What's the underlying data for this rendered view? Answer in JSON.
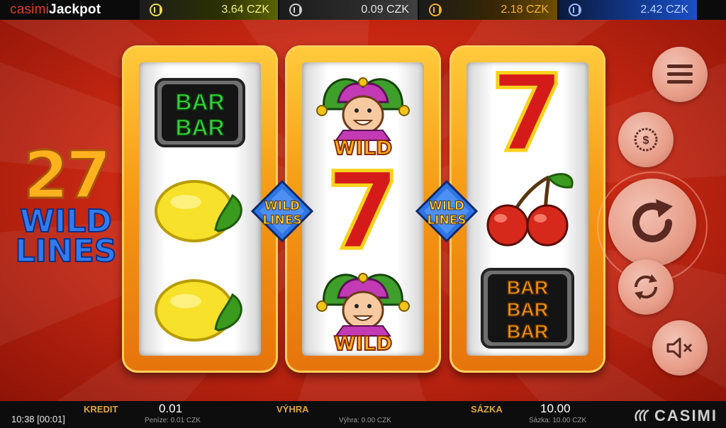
{
  "brand": {
    "part1": "casimi",
    "part2": "Jackpot"
  },
  "jackpots": [
    {
      "value": "3.64 CZK",
      "icon": "coin-icon",
      "color": "#f4ef86"
    },
    {
      "value": "0.09 CZK",
      "icon": "coin-icon",
      "color": "#e2e2e2"
    },
    {
      "value": "2.18 CZK",
      "icon": "coin-icon",
      "color": "#f2b12e"
    },
    {
      "value": "2.42 CZK",
      "icon": "coin-icon",
      "color": "#b9d2ff"
    }
  ],
  "game": {
    "title_number": "27",
    "title_line1": "WILD",
    "title_line2": "LINES",
    "badge_line1": "WILD",
    "badge_line2": "LINES",
    "reels": [
      [
        {
          "symbol": "bar-bar",
          "label1": "BAR",
          "label2": "BAR"
        },
        {
          "symbol": "lemon"
        },
        {
          "symbol": "lemon"
        }
      ],
      [
        {
          "symbol": "wild-joker",
          "label": "WILD"
        },
        {
          "symbol": "seven",
          "label": "7"
        },
        {
          "symbol": "wild-joker",
          "label": "WILD"
        }
      ],
      [
        {
          "symbol": "seven",
          "label": "7"
        },
        {
          "symbol": "cherries"
        },
        {
          "symbol": "bar-bar-bar",
          "label1": "BAR",
          "label2": "BAR",
          "label3": "BAR"
        }
      ]
    ]
  },
  "controls": [
    {
      "name": "menu-button",
      "icon": "hamburger-icon"
    },
    {
      "name": "coin-value-button",
      "icon": "dollar-coin-icon"
    },
    {
      "name": "spin-button",
      "icon": "spin-arrow-icon"
    },
    {
      "name": "autoplay-button",
      "icon": "autoplay-icon"
    },
    {
      "name": "sound-button",
      "icon": "sound-muted-icon"
    }
  ],
  "footer": {
    "clock": "10:38 [00:01]",
    "credit_label": "KREDIT",
    "credit_value": "0.01",
    "credit_sub": "Peníze: 0.01 CZK",
    "win_label": "VÝHRA",
    "win_value": "",
    "win_sub": "Výhra: 0.00 CZK",
    "bet_label": "SÁZKA",
    "bet_value": "10.00",
    "bet_sub": "Sázka: 10.00 CZK",
    "logo": "CASIMI"
  },
  "colors": {
    "accent": "#e23b2b",
    "reel_frame": "#f69a14",
    "footer_label": "#e0a63a"
  }
}
